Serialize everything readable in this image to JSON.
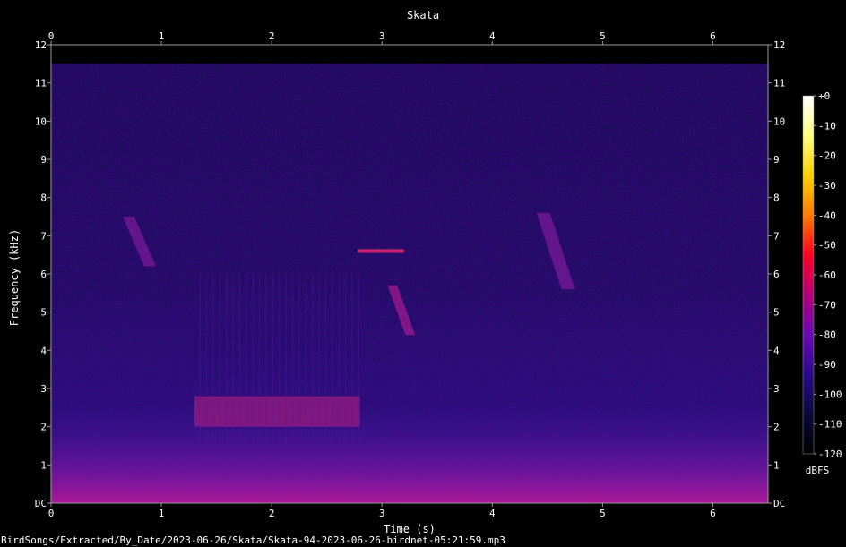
{
  "chart_data": {
    "type": "heatmap",
    "title": "Skata",
    "xlabel": "Time (s)",
    "ylabel": "Frequency (kHz)",
    "xlim": [
      0,
      6.5
    ],
    "ylim": [
      0,
      12
    ],
    "x_ticks": [
      "0",
      "1",
      "2",
      "3",
      "4",
      "5",
      "6"
    ],
    "y_ticks": [
      "DC",
      "1",
      "2",
      "3",
      "4",
      "5",
      "6",
      "7",
      "8",
      "9",
      "10",
      "11",
      "12"
    ],
    "colorbar": {
      "label": "dBFS",
      "range": [
        -120,
        0
      ],
      "ticks": [
        "+0",
        "-10",
        "-20",
        "-30",
        "-40",
        "-50",
        "-60",
        "-70",
        "-80",
        "-90",
        "-100",
        "-110",
        "-120"
      ],
      "colors": [
        "#000000",
        "#0a0a3c",
        "#2a0a8c",
        "#6a0ab4",
        "#b4007a",
        "#ff0022",
        "#ff7a00",
        "#ffd000",
        "#ffff80",
        "#ffffff"
      ]
    },
    "grid": false,
    "visible_energy_max_khz": 11.5,
    "features": [
      {
        "name": "low-frequency noise",
        "t": [
          0,
          6.5
        ],
        "f_khz": [
          0,
          1.2
        ],
        "level_db": -65
      },
      {
        "name": "broadband harmonic call",
        "t": [
          1.3,
          2.8
        ],
        "f_khz": [
          2,
          2.8
        ],
        "level_db": -72
      },
      {
        "name": "descending chirp",
        "t": [
          0.65,
          0.95
        ],
        "f_khz": [
          6.2,
          7.5
        ],
        "level_db": -78
      },
      {
        "name": "narrow tone",
        "t": [
          2.78,
          3.2
        ],
        "f_khz": [
          6.55,
          6.65
        ],
        "level_db": -70
      },
      {
        "name": "descending chirp",
        "t": [
          3.05,
          3.3
        ],
        "f_khz": [
          4.4,
          5.7
        ],
        "level_db": -75
      },
      {
        "name": "descending chirp",
        "t": [
          4.4,
          4.75
        ],
        "f_khz": [
          5.6,
          7.6
        ],
        "level_db": -80
      }
    ]
  },
  "footer": {
    "filepath": "BirdSongs/Extracted/By_Date/2023-06-26/Skata/Skata-94-2023-06-26-birdnet-05:21:59.mp3"
  }
}
